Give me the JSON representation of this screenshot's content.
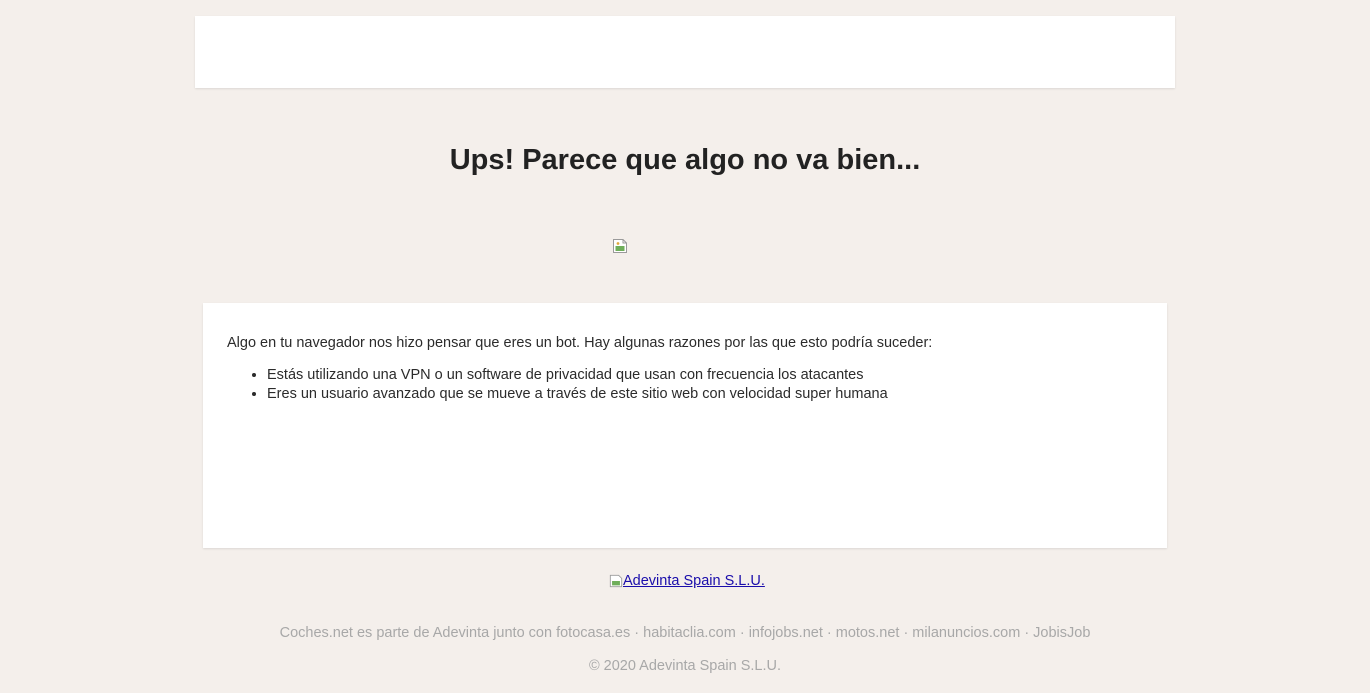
{
  "page": {
    "title": "Ups! Parece que algo no va bien..."
  },
  "message": {
    "intro": "Algo en tu navegador nos hizo pensar que eres un bot. Hay algunas razones por las que esto podría suceder:",
    "reasons": [
      "Estás utilizando una VPN o un software de privacidad que usan con frecuencia los atacantes",
      "Eres un usuario avanzado que se mueve a través de este sitio web con velocidad super humana"
    ]
  },
  "footer": {
    "logo_alt": "Adevinta Spain S.L.U.",
    "sites": "Coches.net es parte de Adevinta junto con fotocasa.es · habitaclia.com · infojobs.net · motos.net · milanuncios.com · JobisJob",
    "copyright": "© 2020 Adevinta Spain S.L.U."
  },
  "colors": {
    "background": "#f4efeb",
    "card": "#ffffff",
    "link": "#1a0dab",
    "footer_text": "#a8a8a8"
  }
}
